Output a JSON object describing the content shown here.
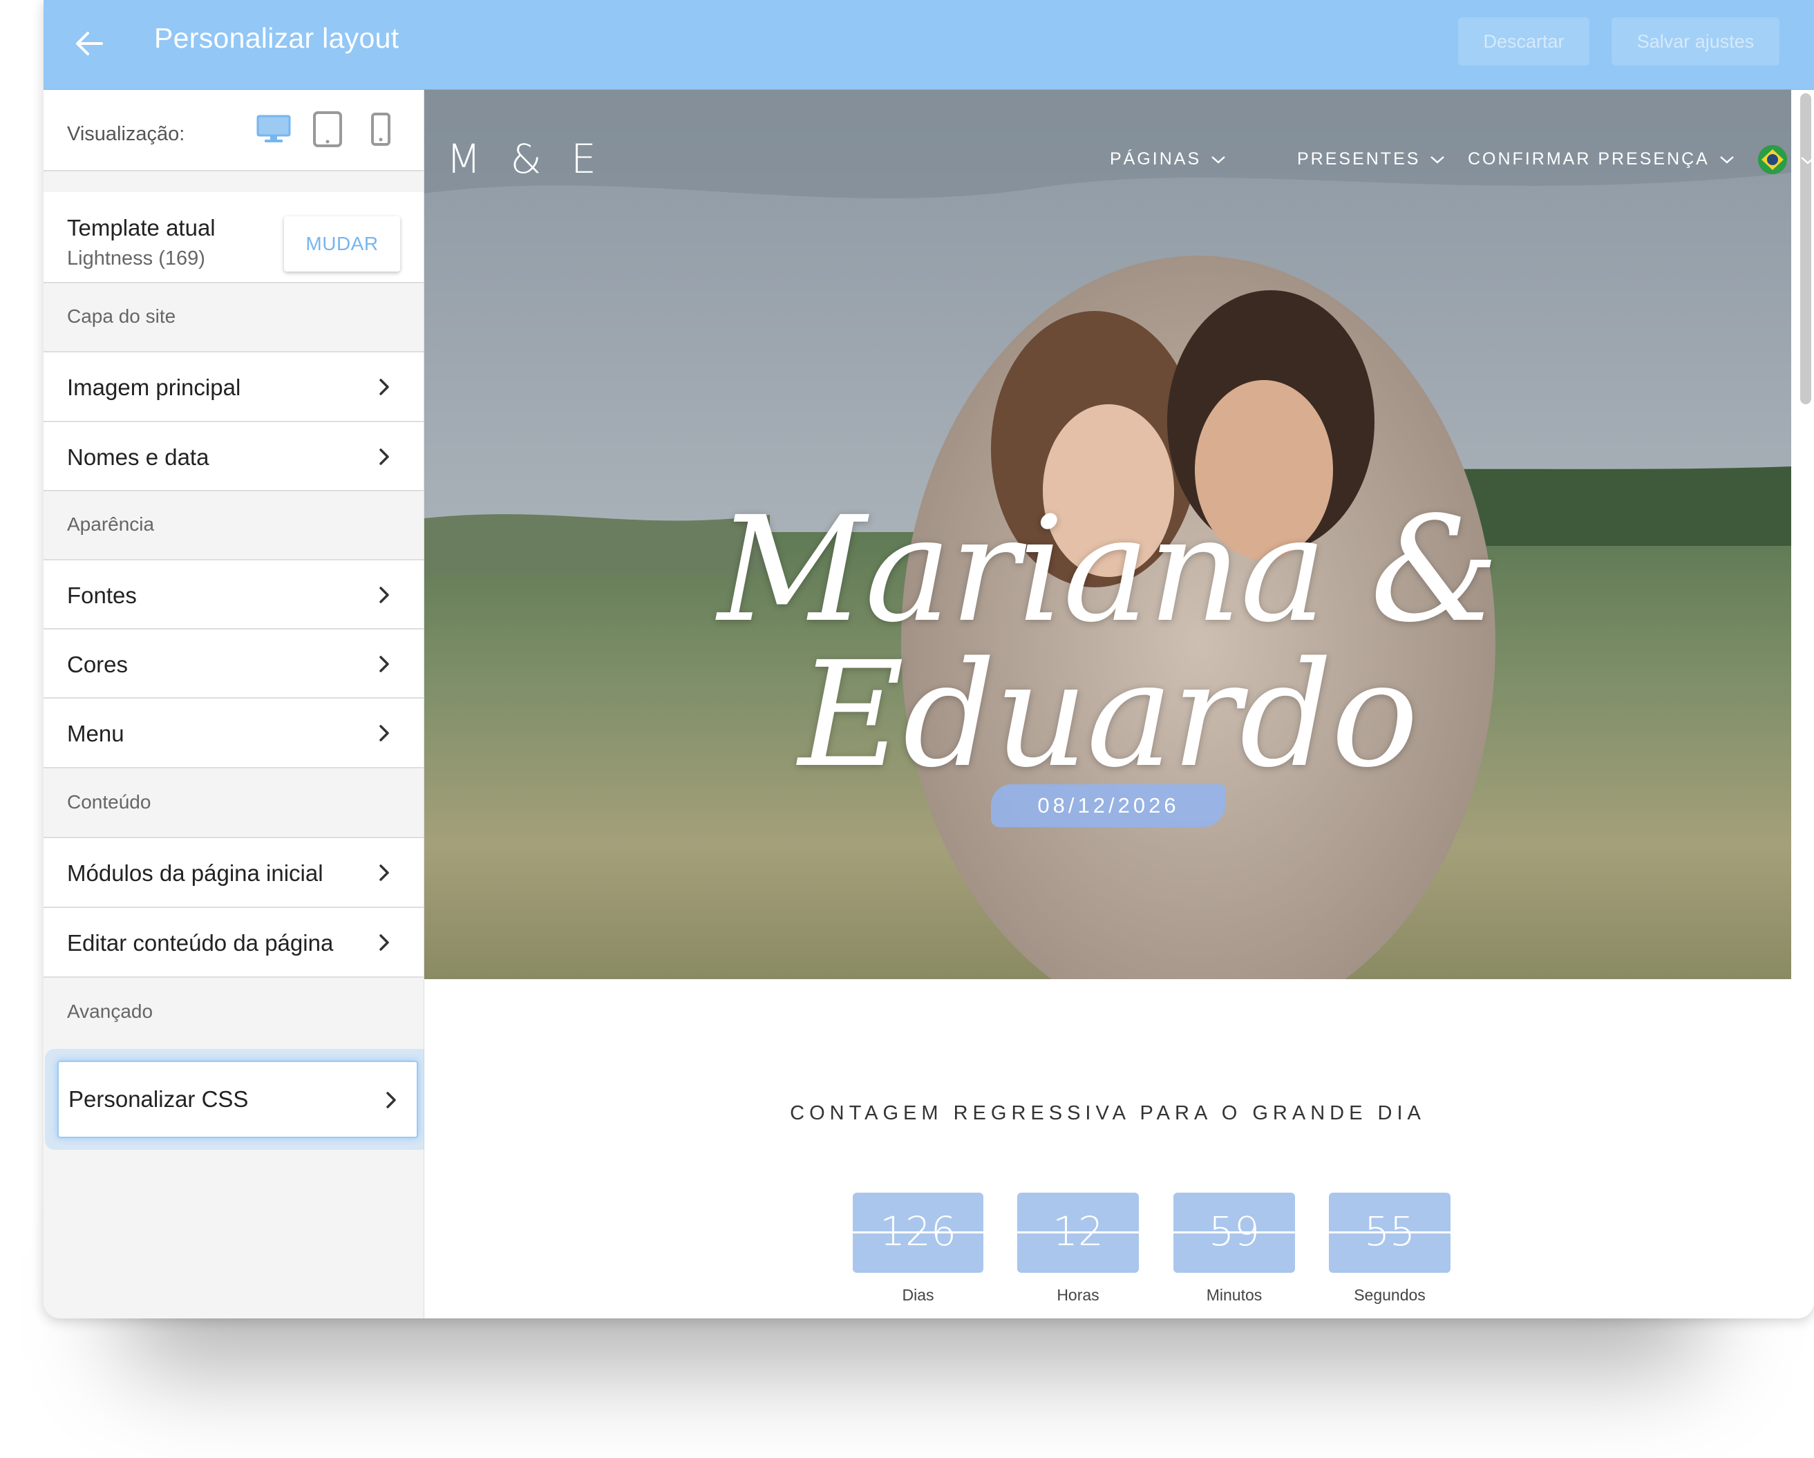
{
  "header": {
    "title": "Personalizar layout",
    "discard_label": "Descartar",
    "save_label": "Salvar ajustes"
  },
  "sidebar": {
    "view_label": "Visualização:",
    "template": {
      "title": "Template atual",
      "name": "Lightness (169)",
      "change_label": "MUDAR"
    },
    "sections": [
      {
        "label": "Capa do site",
        "items": [
          "Imagem principal",
          "Nomes e data"
        ]
      },
      {
        "label": "Aparência",
        "items": [
          "Fontes",
          "Cores",
          "Menu"
        ]
      },
      {
        "label": "Conteúdo",
        "items": [
          "Módulos da página inicial",
          "Editar conteúdo da página"
        ]
      },
      {
        "label": "Avançado",
        "items": [
          "Personalizar CSS"
        ]
      }
    ]
  },
  "preview": {
    "logo": "M & E",
    "nav": [
      "PÁGINAS",
      "PRESENTES",
      "CONFIRMAR PRESENÇA"
    ],
    "names": "Mariana & Eduardo",
    "date": "08/12/2026",
    "countdown_title": "CONTAGEM REGRESSIVA PARA O GRANDE DIA",
    "countdown": [
      {
        "value": "126",
        "label": "Dias"
      },
      {
        "value": "12",
        "label": "Horas"
      },
      {
        "value": "59",
        "label": "Minutos"
      },
      {
        "value": "55",
        "label": "Segundos"
      }
    ]
  },
  "colors": {
    "topbar": "#92c7f6",
    "accent": "#76b6f0",
    "countdown_box": "#aac6ec"
  }
}
